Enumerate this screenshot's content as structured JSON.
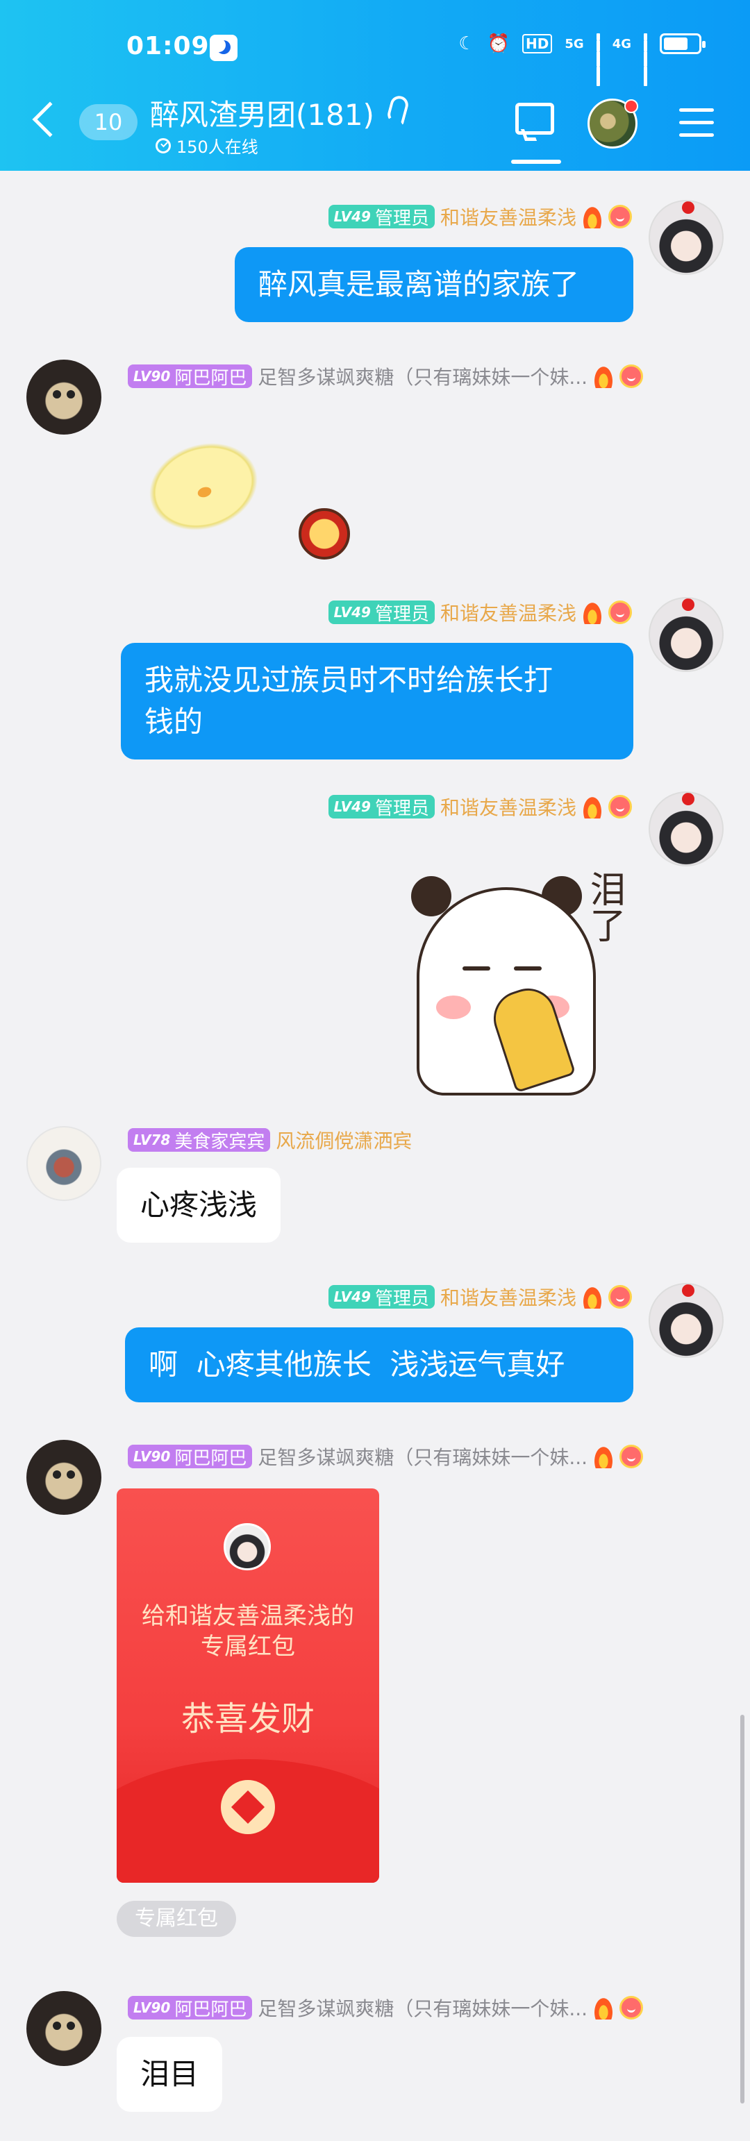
{
  "status_bar": {
    "time": "01:09",
    "hd_label": "HD",
    "net5g": "5G",
    "net4g": "4G"
  },
  "header": {
    "unread_count": "10",
    "group_title": "醉风渣男团(181)",
    "online_text": "150人在线"
  },
  "messages": [
    {
      "side": "right",
      "level": "LV49",
      "role": "管理员",
      "nick": "和谐友善温柔浅",
      "type": "text",
      "text": "醉风真是最离谱的家族了"
    },
    {
      "side": "left",
      "level": "LV90",
      "role": "阿巴阿巴",
      "nick": "足智多谋飒爽糖（只有璃妹妹一个妹...",
      "type": "sticker",
      "sticker": "chick-sticker"
    },
    {
      "side": "right",
      "level": "LV49",
      "role": "管理员",
      "nick": "和谐友善温柔浅",
      "type": "text",
      "text_line1": "我就没见过族员时不时给族长打",
      "text_line2": "钱的"
    },
    {
      "side": "right",
      "level": "LV49",
      "role": "管理员",
      "nick": "和谐友善温柔浅",
      "type": "sticker",
      "sticker_text": "泪了"
    },
    {
      "side": "left",
      "level": "LV78",
      "role": "美食家宾宾",
      "nick": "风流倜傥潇洒宾",
      "type": "text",
      "text": "心疼浅浅"
    },
    {
      "side": "right",
      "level": "LV49",
      "role": "管理员",
      "nick": "和谐友善温柔浅",
      "type": "text",
      "text": "啊  心疼其他族长  浅浅运气真好"
    },
    {
      "side": "left",
      "level": "LV90",
      "role": "阿巴阿巴",
      "nick": "足智多谋飒爽糖（只有璃妹妹一个妹...",
      "type": "redpacket",
      "rp_to_line1": "给和谐友善温柔浅的",
      "rp_to_line2": "专属红包",
      "rp_wish": "恭喜发财",
      "rp_tag": "专属红包"
    },
    {
      "side": "left",
      "level": "LV90",
      "role": "阿巴阿巴",
      "nick": "足智多谋飒爽糖（只有璃妹妹一个妹...",
      "type": "text",
      "text": "泪目"
    }
  ]
}
